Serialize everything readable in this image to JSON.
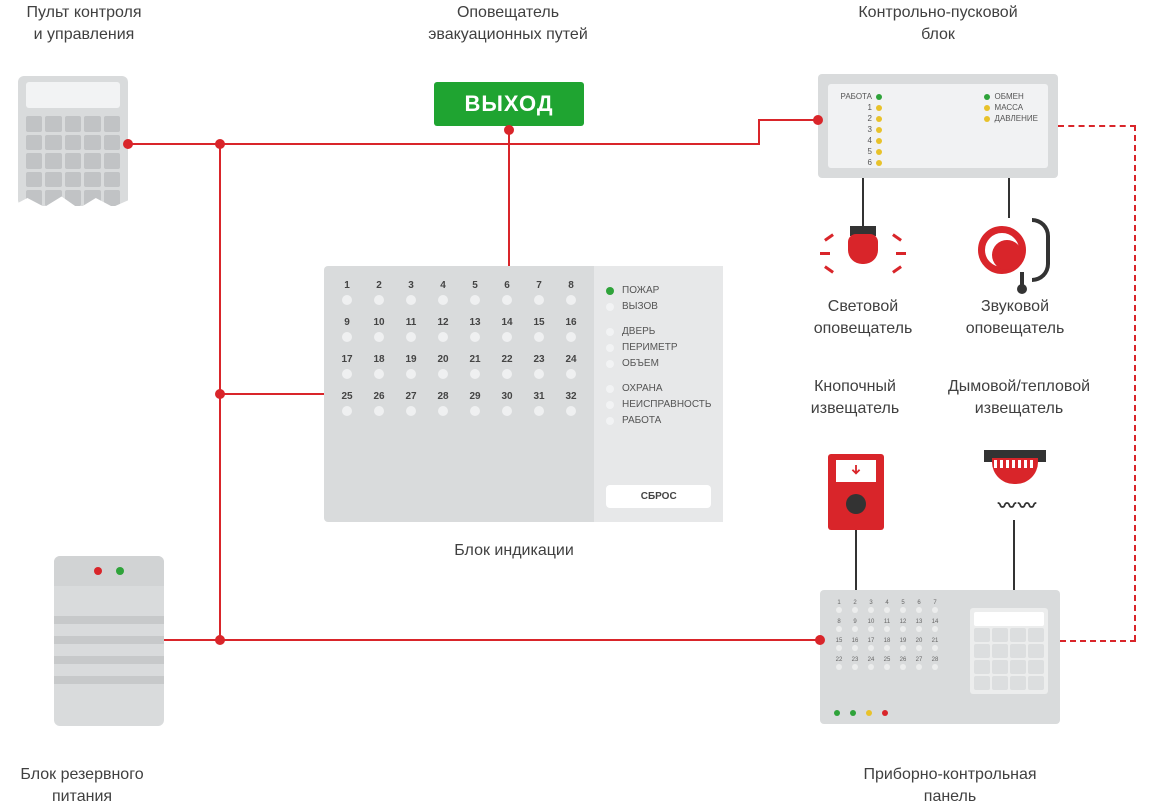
{
  "labels": {
    "control_panel_console": "Пульт контроля\nи управления",
    "exit_notifier": "Оповещатель\nэвакуационных путей",
    "launch_block": "Контрольно-пусковой\nблок",
    "indication_block": "Блок индикации",
    "backup_power": "Блок резервного\nпитания",
    "light_notifier": "Световой\nоповещатель",
    "sound_notifier": "Звуковой\nоповещатель",
    "button_detector": "Кнопочный\nизвещатель",
    "smoke_detector": "Дымовой/тепловой\nизвещатель",
    "instrument_panel": "Приборно-контрольная\nпанель"
  },
  "exit_sign": "ВЫХОД",
  "launch_block_leds": {
    "left": [
      {
        "label": "РАБОТА",
        "color": "green"
      },
      {
        "label": "1",
        "color": "yellow"
      },
      {
        "label": "2",
        "color": "yellow"
      },
      {
        "label": "3",
        "color": "yellow"
      },
      {
        "label": "4",
        "color": "yellow"
      },
      {
        "label": "5",
        "color": "yellow"
      },
      {
        "label": "6",
        "color": "yellow"
      }
    ],
    "right": [
      {
        "label": "ОБМЕН",
        "color": "green"
      },
      {
        "label": "МАССА",
        "color": "yellow"
      },
      {
        "label": "ДАВЛЕНИЕ",
        "color": "yellow"
      }
    ]
  },
  "indication": {
    "zones_rows": [
      [
        "1",
        "2",
        "3",
        "4",
        "5",
        "6",
        "7",
        "8"
      ],
      [
        "9",
        "10",
        "11",
        "12",
        "13",
        "14",
        "15",
        "16"
      ],
      [
        "17",
        "18",
        "19",
        "20",
        "21",
        "22",
        "23",
        "24"
      ],
      [
        "25",
        "26",
        "27",
        "28",
        "29",
        "30",
        "31",
        "32"
      ]
    ],
    "statuses": [
      {
        "label": "ПОЖАР",
        "active": true
      },
      {
        "label": "ВЫЗОВ",
        "active": false
      },
      {
        "label": "ДВЕРЬ",
        "active": false
      },
      {
        "label": "ПЕРИМЕТР",
        "active": false
      },
      {
        "label": "ОБЪЕМ",
        "active": false
      },
      {
        "label": "ОХРАНА",
        "active": false
      },
      {
        "label": "НЕИСПРАВНОСТЬ",
        "active": false
      },
      {
        "label": "РАБОТА",
        "active": false
      }
    ],
    "reset": "СБРОС"
  },
  "bottom_panel_zones": [
    [
      "1",
      "2",
      "3",
      "4",
      "5",
      "6",
      "7"
    ],
    [
      "8",
      "9",
      "10",
      "11",
      "12",
      "13",
      "14"
    ],
    [
      "15",
      "16",
      "17",
      "18",
      "19",
      "20",
      "21"
    ],
    [
      "22",
      "23",
      "24",
      "25",
      "26",
      "27",
      "28"
    ]
  ],
  "colors": {
    "accent_red": "#d9252a",
    "accent_green": "#1fa431",
    "device_gray": "#d9dbdc"
  }
}
